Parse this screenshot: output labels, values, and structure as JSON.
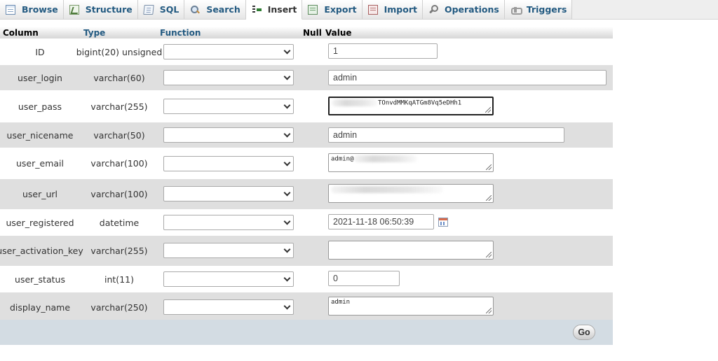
{
  "tabs": [
    {
      "label": "Browse",
      "icon": "browse-icon"
    },
    {
      "label": "Structure",
      "icon": "structure-icon"
    },
    {
      "label": "SQL",
      "icon": "sql-icon"
    },
    {
      "label": "Search",
      "icon": "search-icon"
    },
    {
      "label": "Insert",
      "icon": "insert-icon",
      "active": true
    },
    {
      "label": "Export",
      "icon": "export-icon"
    },
    {
      "label": "Import",
      "icon": "import-icon"
    },
    {
      "label": "Operations",
      "icon": "operations-icon"
    },
    {
      "label": "Triggers",
      "icon": "triggers-icon"
    }
  ],
  "table": {
    "headers": {
      "column": "Column",
      "type": "Type",
      "function": "Function",
      "null": "Null",
      "value": "Value"
    },
    "rows": [
      {
        "name": "ID",
        "type": "bigint(20) unsigned",
        "value": "1"
      },
      {
        "name": "user_login",
        "type": "varchar(60)",
        "value": "admin"
      },
      {
        "name": "user_pass",
        "type": "varchar(255)",
        "value": "TOnvdMMKqATGm8Vq5eDHh1"
      },
      {
        "name": "user_nicename",
        "type": "varchar(50)",
        "value": "admin"
      },
      {
        "name": "user_email",
        "type": "varchar(100)",
        "value": "admin@"
      },
      {
        "name": "user_url",
        "type": "varchar(100)",
        "value": ""
      },
      {
        "name": "user_registered",
        "type": "datetime",
        "value": "2021-11-18 06:50:39"
      },
      {
        "name": "user_activation_key",
        "type": "varchar(255)",
        "value": ""
      },
      {
        "name": "user_status",
        "type": "int(11)",
        "value": "0"
      },
      {
        "name": "display_name",
        "type": "varchar(250)",
        "value": "admin"
      }
    ]
  },
  "footer": {
    "go_label": "Go"
  },
  "colors": {
    "tab_link": "#235a81",
    "row_alt": "#dfdfdf",
    "footer_bg": "#d3dce3"
  }
}
